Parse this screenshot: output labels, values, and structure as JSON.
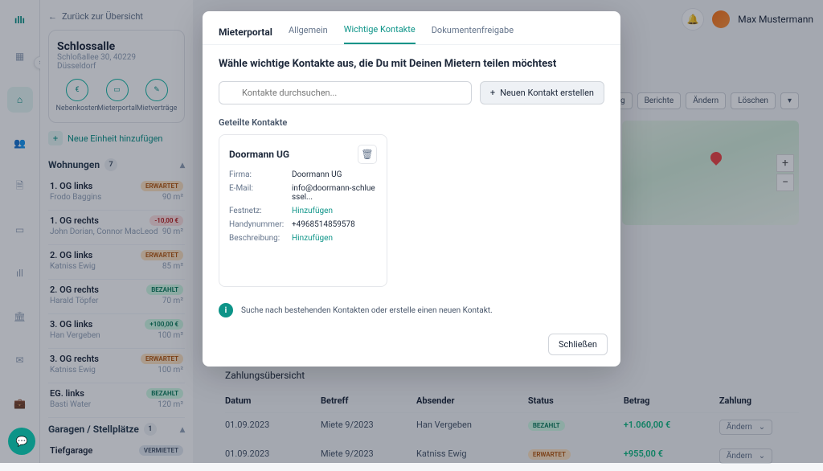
{
  "header": {
    "user_name": "Max Mustermann"
  },
  "sidebar": {
    "back_label": "Zurück zur Übersicht",
    "property_name": "Schlossalle",
    "property_address": "Schloßallee 30, 40229 Düsseldorf",
    "tabs": [
      "Nebenkosten",
      "Mieterportal",
      "Mietverträge"
    ],
    "add_unit_label": "Neue Einheit hinzufügen",
    "section_wohnungen": "Wohnungen",
    "wohnungen_count": "7",
    "section_garagen": "Garagen / Stellplätze",
    "garagen_count": "1",
    "units": [
      {
        "name": "1. OG links",
        "tenant": "Frodo Baggins",
        "area": "90 m²",
        "status": "ERWARTET",
        "status_class": "erwartet"
      },
      {
        "name": "1. OG rechts",
        "tenant": "John Dorian, Connor MacLeod",
        "area": "90 m²",
        "status": "-10,00 €",
        "status_class": "minus"
      },
      {
        "name": "2. OG links",
        "tenant": "Katniss Ewig",
        "area": "85 m²",
        "status": "ERWARTET",
        "status_class": "erwartet"
      },
      {
        "name": "2. OG rechts",
        "tenant": "Harald Töpfer",
        "area": "70 m²",
        "status": "BEZAHLT",
        "status_class": "bezahlt"
      },
      {
        "name": "3. OG links",
        "tenant": "Han Vergeben",
        "area": "100 m²",
        "status": "+100,00 €",
        "status_class": "plus-g"
      },
      {
        "name": "3. OG rechts",
        "tenant": "Katniss Ewig",
        "area": "100 m²",
        "status": "ERWARTET",
        "status_class": "erwartet"
      },
      {
        "name": "EG. links",
        "tenant": "Basti Water",
        "area": "120 m²",
        "status": "BEZAHLT",
        "status_class": "bezahlt"
      }
    ],
    "garage": {
      "name": "Tiefgarage",
      "status": "VERMIETET"
    }
  },
  "actions": {
    "erklaerung": "erklärung",
    "berichte": "Berichte",
    "aendern": "Ändern",
    "loeschen": "Löschen"
  },
  "payments": {
    "title": "Zahlungsübersicht",
    "cols": {
      "datum": "Datum",
      "betreff": "Betreff",
      "absender": "Absender",
      "status": "Status",
      "betrag": "Betrag",
      "zahlung": "Zahlung"
    },
    "rows": [
      {
        "datum": "01.09.2023",
        "betreff": "Miete 9/2023",
        "absender": "Han Vergeben",
        "status": "BEZAHLT",
        "status_class": "bezahlt",
        "betrag": "+1.060,00 €",
        "zahlung": "Ändern"
      },
      {
        "datum": "01.09.2023",
        "betreff": "Miete 9/2023",
        "absender": "Katniss Ewig",
        "status": "ERWARTET",
        "status_class": "erwartet",
        "betrag": "+955,00 €",
        "zahlung": "Ändern"
      }
    ]
  },
  "modal": {
    "brand": "Mieterportal",
    "tabs": {
      "allgemein": "Allgemein",
      "kontakte": "Wichtige Kontakte",
      "dokumente": "Dokumentenfreigabe"
    },
    "title": "Wähle wichtige Kontakte aus, die Du mit Deinen Mietern teilen möchtest",
    "search_placeholder": "Kontakte durchsuchen...",
    "new_contact_label": "Neuen Kontakt erstellen",
    "shared_heading": "Geteilte Kontakte",
    "contact": {
      "name": "Doormann UG",
      "labels": {
        "firma": "Firma:",
        "email": "E-Mail:",
        "festnetz": "Festnetz:",
        "handy": "Handynummer:",
        "beschreibung": "Beschreibung:"
      },
      "firma": "Doormann UG",
      "email": "info@doormann-schluessel...",
      "festnetz": "Hinzufügen",
      "handy": "+4968514859578",
      "beschreibung": "Hinzufügen"
    },
    "info_text": "Suche nach bestehenden Kontakten oder erstelle einen neuen Kontakt.",
    "close_label": "Schließen"
  }
}
